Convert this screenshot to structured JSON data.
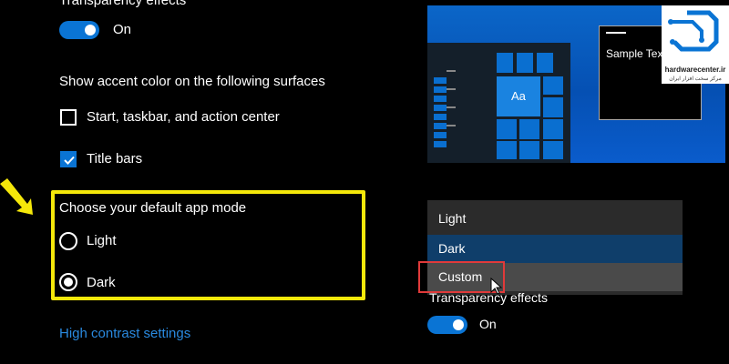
{
  "settings": {
    "transparency_label_top": "Transparency effects",
    "transparency_value_top": "On",
    "accent_heading": "Show accent color on the following surfaces",
    "start_taskbar_label": "Start, taskbar, and action center",
    "start_taskbar_checked": false,
    "title_bars_label": "Title bars",
    "title_bars_checked": true,
    "app_mode_heading": "Choose your default app mode",
    "app_mode_options": [
      {
        "label": "Light",
        "selected": false
      },
      {
        "label": "Dark",
        "selected": true
      }
    ],
    "high_contrast_link": "High contrast settings"
  },
  "preview": {
    "tile_text": "Aa",
    "sample_text": "Sample Text"
  },
  "dropdown": {
    "options": [
      "Light",
      "Dark",
      "Custom"
    ],
    "selected": "Dark",
    "hovered": "Custom"
  },
  "right_panel": {
    "transparency_label": "Transparency effects",
    "transparency_value": "On"
  },
  "watermark": {
    "site": "hardwarecenter.ir",
    "subtitle": "مرکز سخت افزار ایران"
  },
  "colors": {
    "accent": "#0a74d4",
    "highlight_box": "#f5e80a",
    "red_box": "#e03a3a",
    "link": "#2a8ae0"
  }
}
